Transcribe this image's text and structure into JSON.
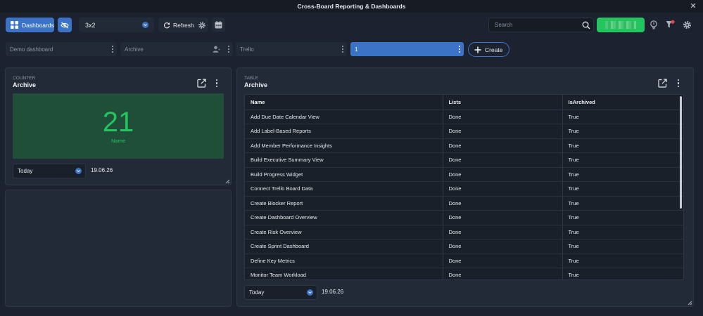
{
  "window": {
    "title": "Cross-Board Reporting & Dashboards",
    "close_label": "✕"
  },
  "toolbar": {
    "dashboards_label": "Dashboards",
    "layout_value": "3x2",
    "refresh_label": "Refresh",
    "search_placeholder": "Search"
  },
  "tabs": [
    {
      "label": "Demo dashboard"
    },
    {
      "label": "Archive"
    },
    {
      "label": "Trello"
    },
    {
      "label": "1"
    }
  ],
  "create_label": "Create",
  "counter_panel": {
    "type_label": "COUNTER",
    "title": "Archive",
    "value": "21",
    "value_label": "Name",
    "period": "Today",
    "date": "19.06.26"
  },
  "table_panel": {
    "type_label": "TABLE",
    "title": "Archive",
    "columns": [
      "Name",
      "Lists",
      "IsArchived"
    ],
    "rows": [
      [
        "Add Due Date Calendar View",
        "Done",
        "True"
      ],
      [
        "Add Label-Based Reports",
        "Done",
        "True"
      ],
      [
        "Add Member Performance Insights",
        "Done",
        "True"
      ],
      [
        "Build Executive Summary View",
        "Done",
        "True"
      ],
      [
        "Build Progress Widget",
        "Done",
        "True"
      ],
      [
        "Connect Trello Board Data",
        "Done",
        "True"
      ],
      [
        "Create Blocker Report",
        "Done",
        "True"
      ],
      [
        "Create Dashboard Overview",
        "Done",
        "True"
      ],
      [
        "Create Risk Overview",
        "Done",
        "True"
      ],
      [
        "Create Sprint Dashboard",
        "Done",
        "True"
      ],
      [
        "Define Key Metrics",
        "Done",
        "True"
      ],
      [
        "Monitor Team Workload",
        "Done",
        "True"
      ]
    ],
    "period": "Today",
    "date": "19.06.26"
  },
  "colors": {
    "accent": "#3b73c6",
    "counter_green": "#22c55e",
    "counter_bg": "#1f4f39",
    "panel_bg": "#232a37",
    "app_bg": "#1c2230"
  },
  "icons": [
    "grid-icon",
    "eye-off-icon",
    "refresh-icon",
    "gear-icon",
    "calendar-icon",
    "search-icon",
    "lightbulb-icon",
    "notification-icon",
    "plus-icon",
    "external-link-icon",
    "kebab-icon",
    "chevron-down-icon",
    "person-icon",
    "resize-icon"
  ]
}
